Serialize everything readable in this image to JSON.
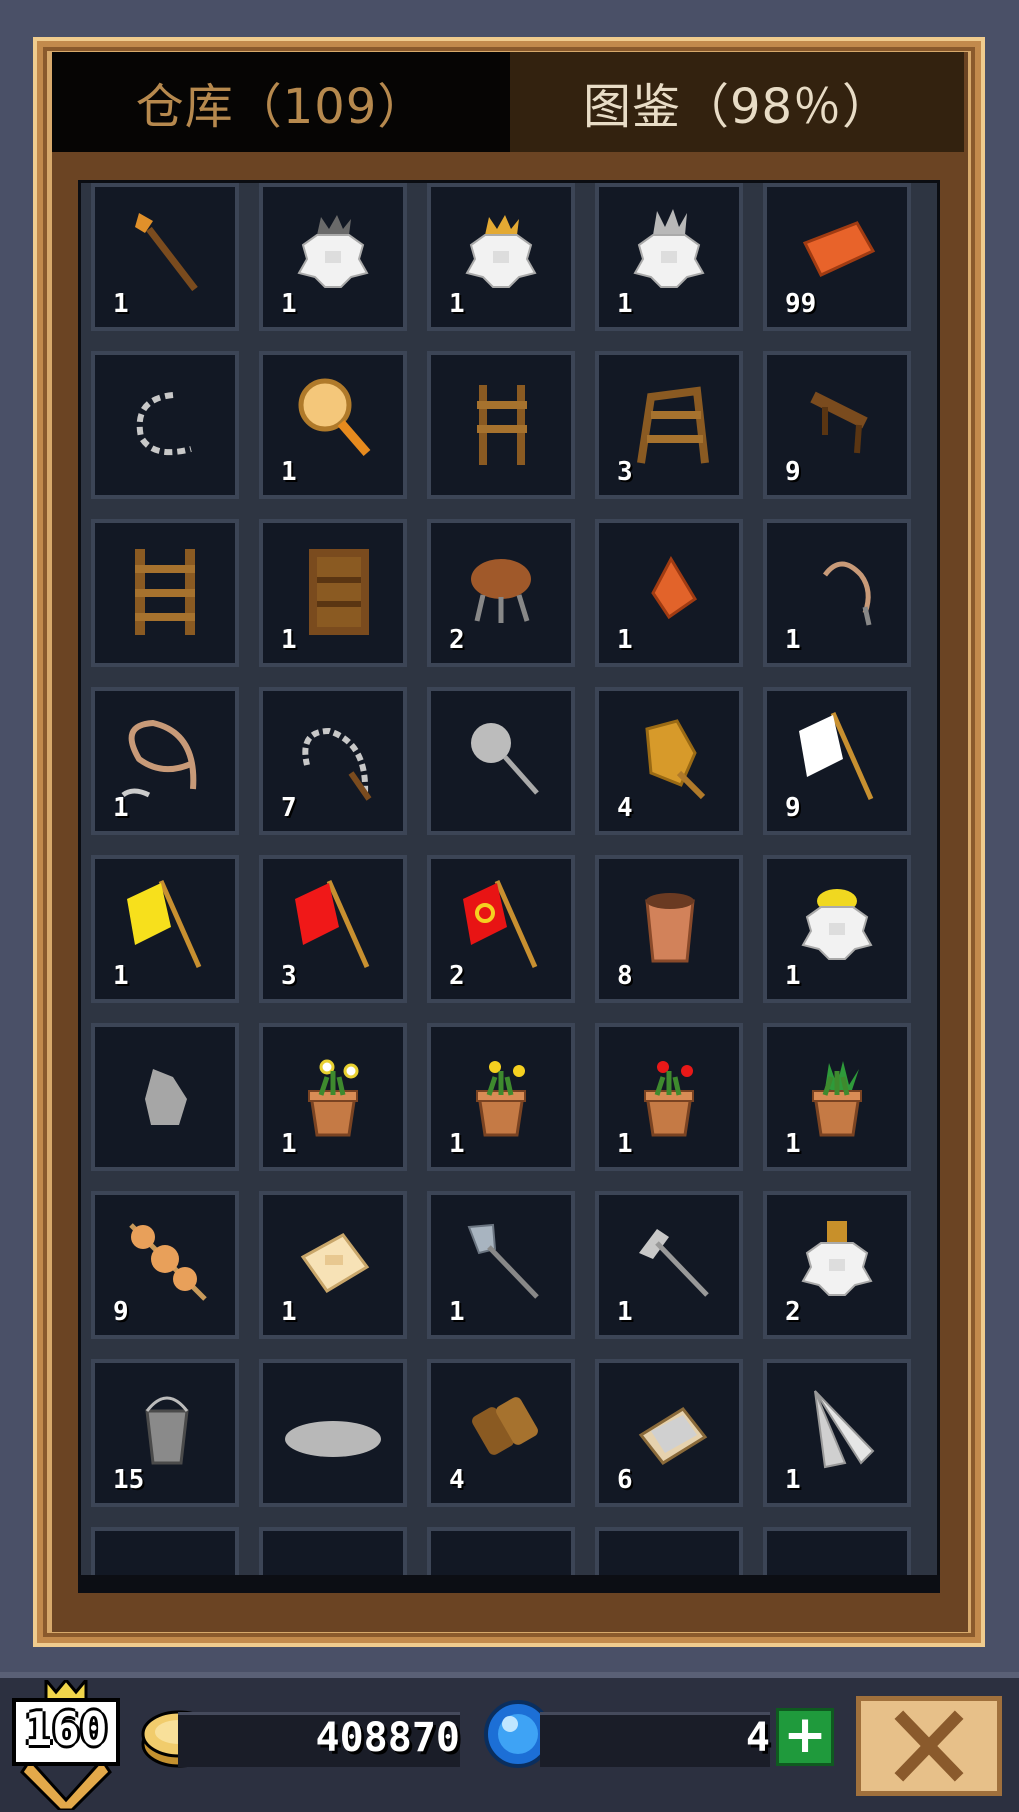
{
  "tabs": {
    "warehouse": "仓库（109）",
    "codex": "图鉴（98％）"
  },
  "slots": [
    {
      "icon": "torch-icon",
      "count": "1"
    },
    {
      "icon": "wolf-pelt-gray-icon",
      "count": "1"
    },
    {
      "icon": "wolf-pelt-gold-icon",
      "count": "1"
    },
    {
      "icon": "wolf-pelt-silver-icon",
      "count": "1"
    },
    {
      "icon": "brick-icon",
      "count": "99"
    },
    {
      "icon": "chain-icon",
      "count": ""
    },
    {
      "icon": "magnifier-icon",
      "count": "1"
    },
    {
      "icon": "wooden-ladder-short-icon",
      "count": ""
    },
    {
      "icon": "wooden-rack-icon",
      "count": "3"
    },
    {
      "icon": "wooden-bench-icon",
      "count": "9"
    },
    {
      "icon": "wooden-ladder-icon",
      "count": ""
    },
    {
      "icon": "wooden-shelf-icon",
      "count": "1"
    },
    {
      "icon": "meat-stool-icon",
      "count": "2"
    },
    {
      "icon": "orange-gem-icon",
      "count": "1"
    },
    {
      "icon": "small-whip-icon",
      "count": "1"
    },
    {
      "icon": "rope-whip-icon",
      "count": "1"
    },
    {
      "icon": "iron-chain-whip-icon",
      "count": "7"
    },
    {
      "icon": "fishing-net-icon",
      "count": ""
    },
    {
      "icon": "golden-net-icon",
      "count": "4"
    },
    {
      "icon": "white-flag-icon",
      "count": "9"
    },
    {
      "icon": "yellow-flag-icon",
      "count": "1"
    },
    {
      "icon": "red-flag-icon",
      "count": "3"
    },
    {
      "icon": "red-hammer-sickle-flag-icon",
      "count": "2"
    },
    {
      "icon": "clay-pot-icon",
      "count": "8"
    },
    {
      "icon": "straw-hat-pelt-icon",
      "count": "1"
    },
    {
      "icon": "gray-sack-icon",
      "count": ""
    },
    {
      "icon": "potted-white-flower-icon",
      "count": "1"
    },
    {
      "icon": "potted-yellow-flower-icon",
      "count": "1"
    },
    {
      "icon": "potted-red-flower-icon",
      "count": "1"
    },
    {
      "icon": "potted-aloe-icon",
      "count": "1"
    },
    {
      "icon": "meat-skewer-icon",
      "count": "9"
    },
    {
      "icon": "soap-bar-icon",
      "count": "1"
    },
    {
      "icon": "shovel-icon",
      "count": "1"
    },
    {
      "icon": "pickaxe-icon",
      "count": "1"
    },
    {
      "icon": "pelt-with-item-icon",
      "count": "2"
    },
    {
      "icon": "metal-bucket-icon",
      "count": "15"
    },
    {
      "icon": "gray-platter-icon",
      "count": ""
    },
    {
      "icon": "wood-logs-icon",
      "count": "4"
    },
    {
      "icon": "cloth-bundle-icon",
      "count": "6"
    },
    {
      "icon": "folding-fan-icon",
      "count": "1"
    },
    {
      "icon": "green-item-icon",
      "count": ""
    },
    {
      "icon": "white-item-icon",
      "count": ""
    },
    {
      "icon": "brown-chest-icon",
      "count": ""
    },
    {
      "icon": "blue-item-icon",
      "count": ""
    },
    {
      "icon": "red-book-icon",
      "count": ""
    }
  ],
  "status": {
    "level": "160",
    "gold": "408870",
    "gems": "4"
  },
  "colors": {
    "frame_gold": "#d7a96b",
    "tab_active_text": "#b6894e",
    "slot_bg": "#121824",
    "slot_border": "#3c4556"
  }
}
